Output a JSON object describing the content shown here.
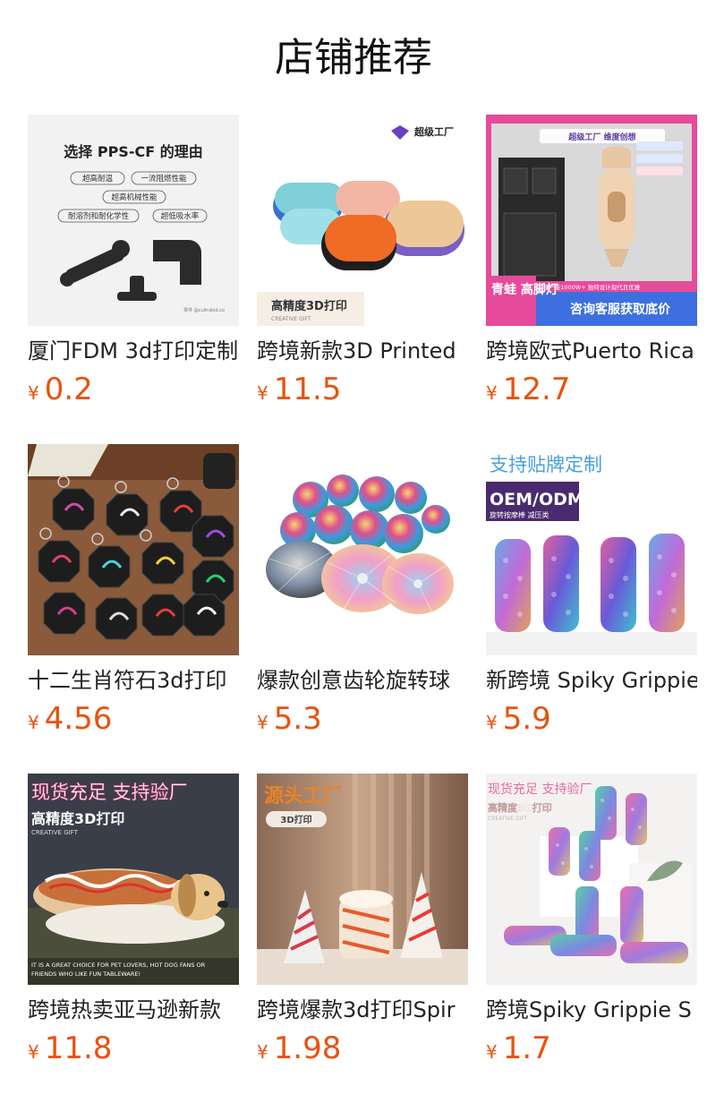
{
  "section": {
    "title": "店铺推荐"
  },
  "currency": "¥",
  "products": [
    {
      "name": "厦门FDM 3d打印定制",
      "price": "0.2",
      "image": {
        "icon": "black-3d-printed-parts-image",
        "heading": "选择 PPS-CF 的理由",
        "tags": [
          "超高耐温",
          "一流阻燃性能",
          "超高机械性能",
          "耐溶剂和耐化学性",
          "超低吸水率"
        ]
      }
    },
    {
      "name": "跨境新款3D Printed",
      "price": "11.5",
      "image": {
        "icon": "pastel-massage-stones-image",
        "brand": "超级工厂",
        "caption": "高精度3D打印",
        "subcaption": "CREATIVE GIFT"
      }
    },
    {
      "name": "跨境欧式Puerto Rica",
      "price": "12.7",
      "image": {
        "icon": "lantern-house-decor-image",
        "brand": "超级工厂 维度创想",
        "badge": "青蛙 高脚灯",
        "banner": "咨询客服获取底价",
        "strip": "日产能1000W+ 独特设计现代且优雅"
      }
    },
    {
      "name": "十二生肖符石3d打印",
      "price": "4.56",
      "image": {
        "icon": "zodiac-keychains-image"
      }
    },
    {
      "name": "爆款创意齿轮旋转球",
      "price": "5.3",
      "image": {
        "icon": "rainbow-gear-balls-image"
      }
    },
    {
      "name": "新跨境 Spiky Grippie",
      "price": "5.9",
      "image": {
        "icon": "spiky-fidget-tubes-image",
        "top": "支持贴牌定制",
        "label": "OEM/ODM",
        "sub": "旋转按摩棒 减压类"
      }
    },
    {
      "name": "跨境热卖亚马逊新款",
      "price": "11.8",
      "image": {
        "icon": "dachshund-hotdog-image",
        "top": "现货充足 支持验厂",
        "caption": "高精度3D打印",
        "subcaption": "CREATIVE GIFT",
        "footer1": "IT IS A GREAT CHOICE FOR PET LOVERS, HOT DOG FANS OR",
        "footer2": "FRIENDS WHO LIKE FUN TABLEWARE!"
      }
    },
    {
      "name": "跨境爆款3d打印Spir",
      "price": "1.98",
      "image": {
        "icon": "spiral-cone-toys-image",
        "top": "源头工厂",
        "pill": "3D打印"
      }
    },
    {
      "name": "跨境Spiky Grippie S",
      "price": "1.7",
      "image": {
        "icon": "spiky-tubes-display-image",
        "top": "现货充足 支持验厂",
        "caption": "高精度3D打印",
        "subcaption": "CREATIVE GIFT"
      }
    }
  ]
}
